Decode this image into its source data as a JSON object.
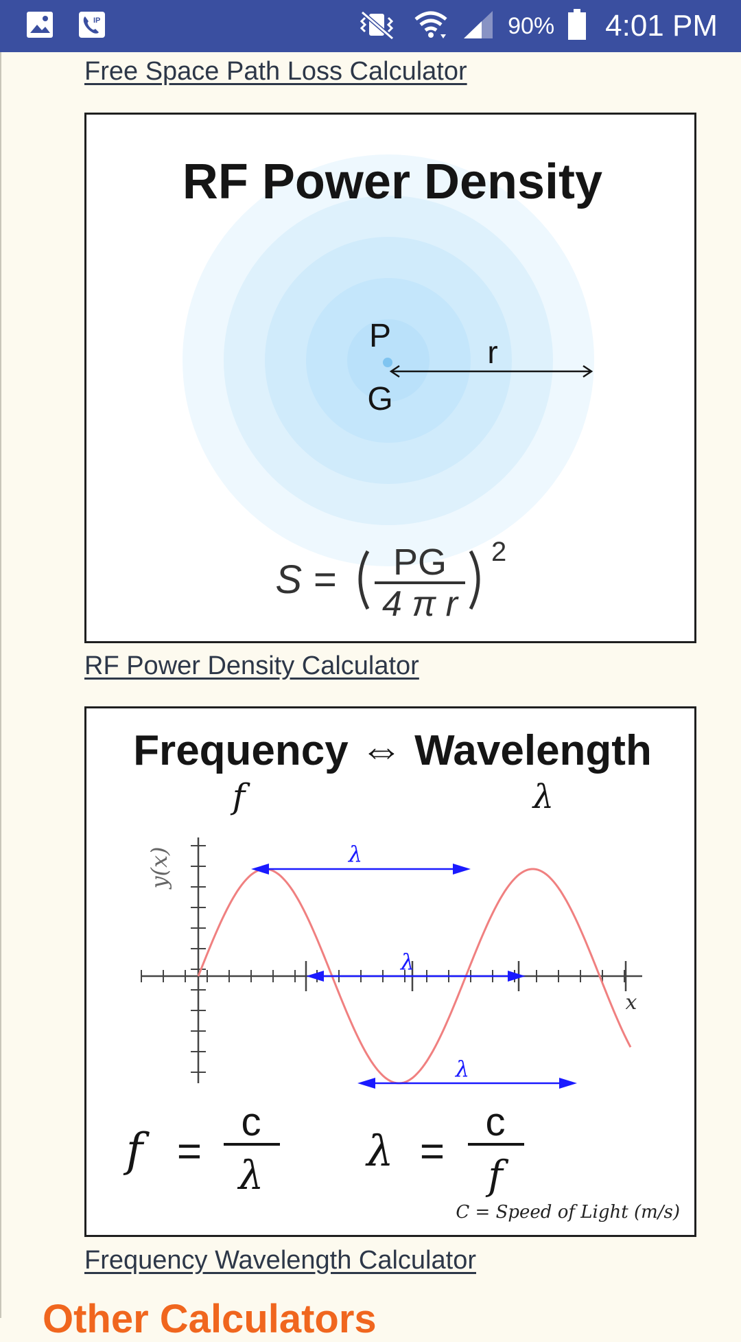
{
  "status_bar": {
    "battery": "90%",
    "time": "4:01 PM",
    "icons": [
      "gallery-icon",
      "voip-call-icon",
      "vibrate-mute-icon",
      "wifi-icon",
      "cell-signal-icon",
      "battery-icon"
    ]
  },
  "links": {
    "free_space_path_loss": "Free Space Path Loss Calculator",
    "rf_power_density": "RF Power Density Calculator",
    "frequency_wavelength": "Frequency Wavelength Calculator"
  },
  "rf_figure": {
    "title": "RF Power Density",
    "label_p": "P",
    "label_g": "G",
    "label_r": "r",
    "formula_lhs": "S =",
    "formula_num": "PG",
    "formula_den": "4 π r",
    "formula_exp": "2"
  },
  "freq_figure": {
    "title": "Frequency ⇔ Wavelength",
    "sym_f": "f",
    "sym_lambda": "λ",
    "axis_y": "y(x)",
    "axis_x": "x",
    "lambda_marker": "λ",
    "formula1_lhs": "f",
    "formula1_num": "c",
    "formula1_den": "λ",
    "formula2_lhs": "λ",
    "formula2_num": "c",
    "formula2_den": "f",
    "equals": "=",
    "footnote": "C = Speed of Light (m/s)"
  },
  "sections": {
    "other_calculators": "Other Calculators"
  },
  "colors": {
    "status_bar": "#3a4fa0",
    "page_bg": "#fdfaef",
    "heading_accent": "#f0661e",
    "link_text": "#2d3748",
    "wave": "#f08080",
    "lambda_arrow": "#1a1aff"
  }
}
